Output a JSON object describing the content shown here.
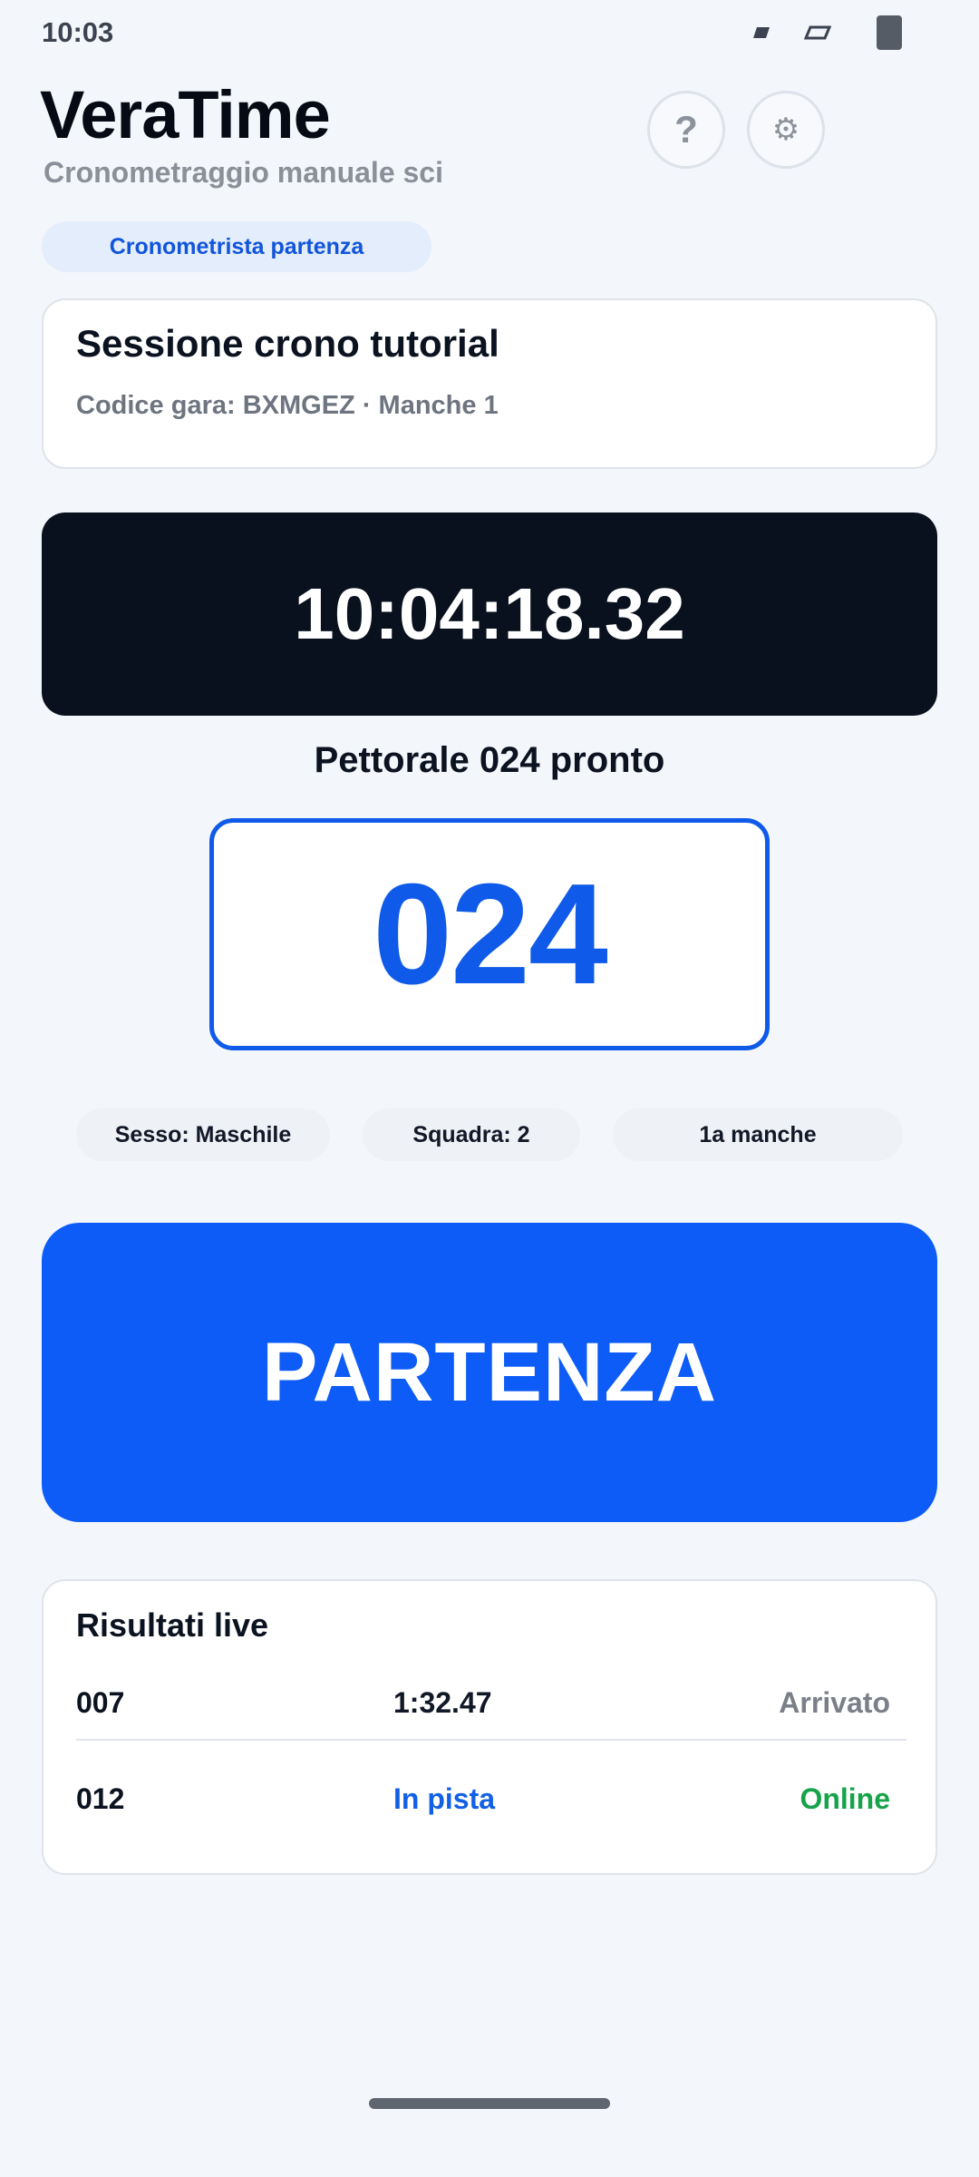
{
  "status_bar": {
    "time": "10:03",
    "icons": [
      "signal-icon",
      "wifi-icon",
      "battery-icon"
    ]
  },
  "header": {
    "title": "VeraTime",
    "subtitle": "Cronometraggio manuale sci",
    "help_icon": "?",
    "settings_icon": "⚙"
  },
  "role": {
    "label": "Cronometrista partenza"
  },
  "session": {
    "name": "Sessione crono tutorial",
    "meta": "Codice gara: BXMGEZ · Manche 1"
  },
  "clock": {
    "time": "10:04:18.32"
  },
  "bib": {
    "status": "Pettorale 024 pronto",
    "number": "024"
  },
  "chips": {
    "sex": "Sesso: Maschile",
    "team": "Squadra: 2",
    "run": "1a manche"
  },
  "start_button": {
    "label": "PARTENZA"
  },
  "results": {
    "title": "Risultati live",
    "rows": [
      {
        "bib": "007",
        "time": "1:32.47",
        "status": "Arrivato"
      },
      {
        "bib": "012",
        "time": "In pista",
        "status": "Online"
      }
    ]
  },
  "colors": {
    "accent": "#0d5cf7",
    "clock_background": "#08111d",
    "online": "#16a34a",
    "background": "#f3f6fb"
  }
}
